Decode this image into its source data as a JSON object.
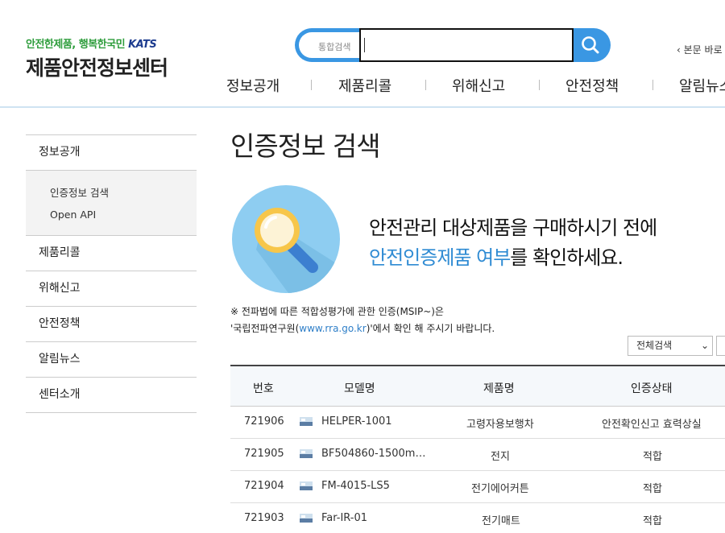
{
  "header": {
    "slogan": "안전한제품, 행복한국민",
    "slogan_brand": "KATS",
    "site_title": "제품안전정보센터",
    "search_placeholder": "통합검색",
    "skip_link": "본문 바로",
    "gnb": [
      "정보공개",
      "제품리콜",
      "위해신고",
      "안전정책",
      "알림뉴스"
    ]
  },
  "sidebar": {
    "items": [
      {
        "label": "정보공개",
        "sub": [
          "인증정보 검색",
          "Open API"
        ]
      },
      {
        "label": "제품리콜"
      },
      {
        "label": "위해신고"
      },
      {
        "label": "안전정책"
      },
      {
        "label": "알림뉴스"
      },
      {
        "label": "센터소개"
      }
    ]
  },
  "main": {
    "title": "인증정보 검색",
    "hero_line1": "안전관리 대상제품을 구매하시기 전에",
    "hero_line2_highlight": "안전인증제품 여부",
    "hero_line2_rest": "를 확인하세요.",
    "notice_line1": "※ 전파법에 따른 적합성평가에 관한 인증(MSIP~)은",
    "notice_line2_prefix": "'국립전파연구원(",
    "notice_line2_link": "www.rra.go.kr",
    "notice_line2_suffix": ")'에서 확인 해 주시기 바랍니다.",
    "filter_value": "전체검색"
  },
  "table": {
    "headers": [
      "번호",
      "모델명",
      "제품명",
      "인증상태"
    ],
    "rows": [
      {
        "no": "721906",
        "model": "HELPER-1001",
        "product": "고령자용보행차",
        "status": "안전확인신고 효력상실"
      },
      {
        "no": "721905",
        "model": "BF504860-1500m…",
        "product": "전지",
        "status": "적합"
      },
      {
        "no": "721904",
        "model": "FM-4015-LS5",
        "product": "전기에어커튼",
        "status": "적합"
      },
      {
        "no": "721903",
        "model": "Far-IR-01",
        "product": "전기매트",
        "status": "적합"
      }
    ]
  },
  "colors": {
    "accent": "#3a97e3",
    "highlight_text": "#2f8bd3",
    "slogan_green": "#2e9d3c",
    "hero_circle": "#8ecdf1"
  }
}
